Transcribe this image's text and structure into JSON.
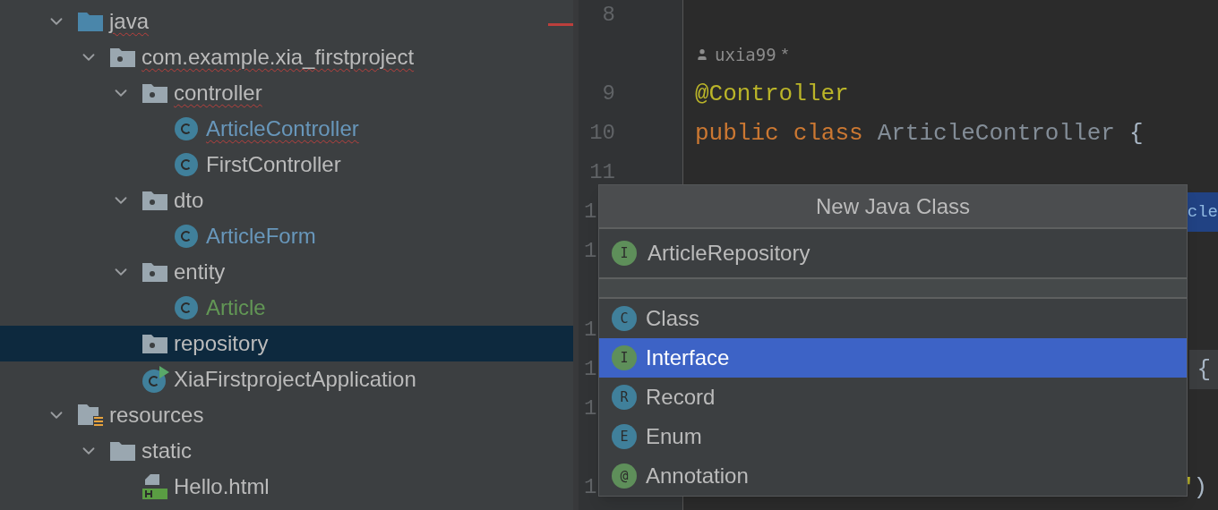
{
  "project_tree": {
    "items": [
      {
        "label": "java",
        "kind": "source-folder",
        "modified": false,
        "added": false,
        "error": true,
        "expanded": true,
        "selected": false,
        "children": [
          {
            "label": "com.example.xia_firstproject",
            "kind": "package",
            "modified": false,
            "added": false,
            "error": true,
            "expanded": true,
            "selected": false,
            "children": [
              {
                "label": "controller",
                "kind": "package",
                "modified": false,
                "added": false,
                "error": true,
                "expanded": true,
                "selected": false,
                "children": [
                  {
                    "label": "ArticleController",
                    "kind": "class",
                    "modified": true,
                    "added": false,
                    "error": true,
                    "selected": false
                  },
                  {
                    "label": "FirstController",
                    "kind": "class",
                    "modified": false,
                    "added": false,
                    "error": false,
                    "selected": false
                  }
                ]
              },
              {
                "label": "dto",
                "kind": "package",
                "modified": false,
                "added": false,
                "error": false,
                "expanded": true,
                "selected": false,
                "children": [
                  {
                    "label": "ArticleForm",
                    "kind": "class",
                    "modified": true,
                    "added": false,
                    "error": false,
                    "selected": false
                  }
                ]
              },
              {
                "label": "entity",
                "kind": "package",
                "modified": false,
                "added": false,
                "error": false,
                "expanded": true,
                "selected": false,
                "children": [
                  {
                    "label": "Article",
                    "kind": "class",
                    "modified": false,
                    "added": true,
                    "error": false,
                    "selected": false
                  }
                ]
              },
              {
                "label": "repository",
                "kind": "package",
                "modified": false,
                "added": false,
                "error": false,
                "selected": true
              },
              {
                "label": "XiaFirstprojectApplication",
                "kind": "app-class",
                "modified": false,
                "added": false,
                "error": false,
                "selected": false
              }
            ]
          }
        ]
      },
      {
        "label": "resources",
        "kind": "resources-folder",
        "modified": false,
        "added": false,
        "error": false,
        "expanded": true,
        "selected": false,
        "children": [
          {
            "label": "static",
            "kind": "folder",
            "modified": false,
            "added": false,
            "error": false,
            "expanded": true,
            "selected": false,
            "children": [
              {
                "label": "Hello.html",
                "kind": "html",
                "modified": false,
                "added": false,
                "error": false,
                "selected": false
              }
            ]
          }
        ]
      }
    ]
  },
  "editor": {
    "lines": [
      {
        "kind": "code",
        "number": "8"
      },
      {
        "kind": "author",
        "author": "uxia99",
        "note": "*"
      },
      {
        "kind": "code",
        "number": "9",
        "code": [
          {
            "text": "@Controller",
            "kind": "annotation"
          }
        ]
      },
      {
        "kind": "code",
        "number": "10",
        "code": [
          {
            "text": "public",
            "kind": "keyword"
          },
          {
            "text": "class",
            "kind": "keyword"
          },
          {
            "text": "ArticleController",
            "kind": "plain"
          },
          {
            "text": "{",
            "kind": "brace"
          }
        ]
      },
      {
        "kind": "code",
        "number": "11"
      },
      {
        "kind": "partial",
        "number": "1",
        "tail": [
          {
            "text": "cle",
            "kind": "selected"
          }
        ]
      },
      {
        "kind": "partial",
        "number": "1"
      },
      {
        "kind": "hidden"
      },
      {
        "kind": "partial",
        "number": "1"
      },
      {
        "kind": "partial",
        "number": "1",
        "tail": [
          {
            "text": "{",
            "kind": "boxed"
          }
        ]
      },
      {
        "kind": "partial",
        "number": "1"
      },
      {
        "kind": "hidden"
      },
      {
        "kind": "partial",
        "number": "1",
        "tail": [
          {
            "text": "\"",
            "kind": "string"
          },
          {
            "text": ")",
            "kind": "brace"
          }
        ]
      }
    ]
  },
  "popup": {
    "title": "New Java Class",
    "input": {
      "value": "ArticleRepository",
      "badge": "I",
      "kind": "interface"
    },
    "items": [
      {
        "label": "Class",
        "badge": "C",
        "kind": "class",
        "selected": false
      },
      {
        "label": "Interface",
        "badge": "I",
        "kind": "interface",
        "selected": true
      },
      {
        "label": "Record",
        "badge": "R",
        "kind": "record",
        "selected": false
      },
      {
        "label": "Enum",
        "badge": "E",
        "kind": "enum",
        "selected": false
      },
      {
        "label": "Annotation",
        "badge": "@",
        "kind": "annotation",
        "selected": false
      }
    ]
  }
}
